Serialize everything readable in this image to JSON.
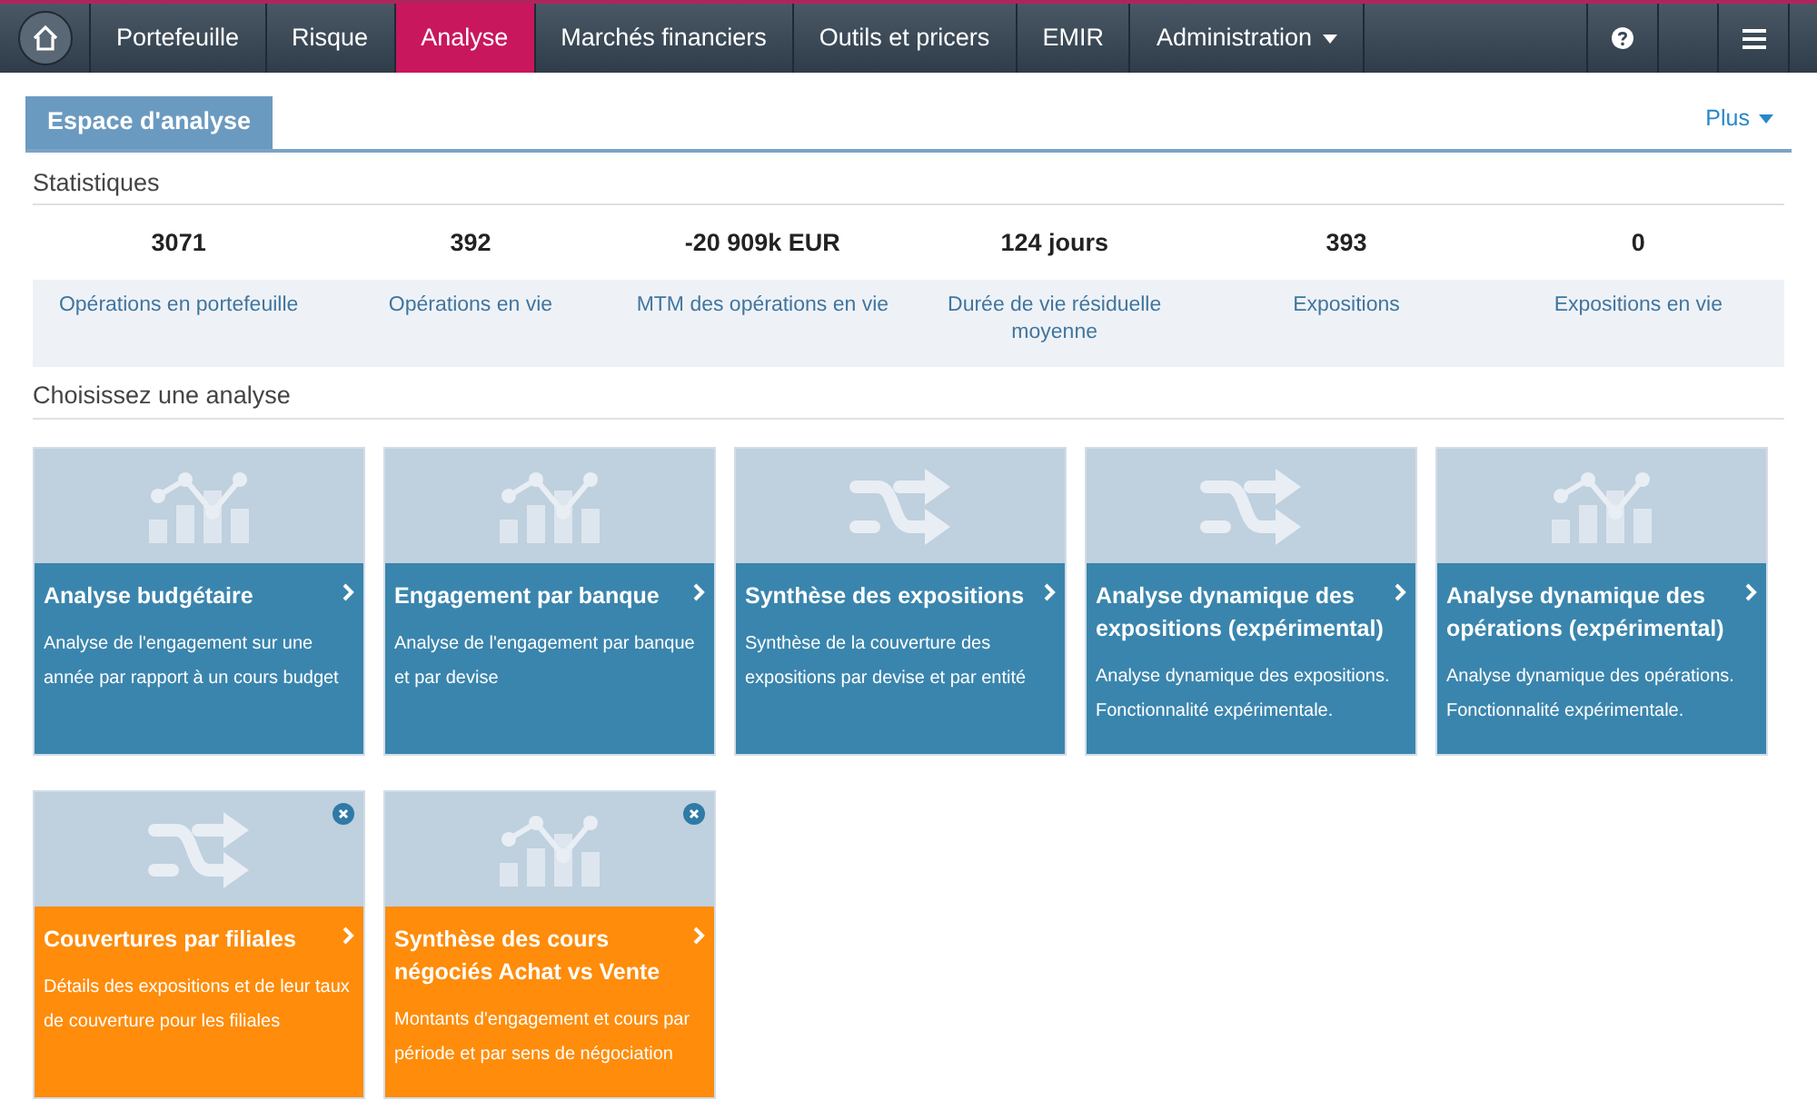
{
  "nav": {
    "items": [
      {
        "label": "Portefeuille",
        "selected": false,
        "dropdown": false
      },
      {
        "label": "Risque",
        "selected": false,
        "dropdown": false
      },
      {
        "label": "Analyse",
        "selected": true,
        "dropdown": false
      },
      {
        "label": "Marchés financiers",
        "selected": false,
        "dropdown": false
      },
      {
        "label": "Outils et pricers",
        "selected": false,
        "dropdown": false
      },
      {
        "label": "EMIR",
        "selected": false,
        "dropdown": false
      },
      {
        "label": "Administration",
        "selected": false,
        "dropdown": true
      }
    ]
  },
  "workspace_tabs": [
    {
      "label": "Espace d'analyse",
      "selected": true
    }
  ],
  "more_menu": "Plus",
  "statistics": {
    "title": "Statistiques",
    "items": [
      {
        "value": "3071",
        "label": "Opérations en portefeuille"
      },
      {
        "value": "392",
        "label": "Opérations en vie"
      },
      {
        "value": "-20 909k EUR",
        "label": "MTM des opérations en vie"
      },
      {
        "value": "124 jours",
        "label": "Durée de vie résiduelle moyenne"
      },
      {
        "value": "393",
        "label": "Expositions"
      },
      {
        "value": "0",
        "label": "Expositions en vie"
      }
    ]
  },
  "analyses": {
    "title": "Choisissez une analyse",
    "cards": [
      {
        "kind": "standard",
        "title": "Analyse budgétaire",
        "description": "Analyse de l'engagement sur une année par rapport à un cours budget"
      },
      {
        "kind": "standard",
        "title": "Engagement par banque",
        "description": "Analyse de l'engagement par banque et par devise"
      },
      {
        "kind": "standard",
        "title": "Synthèse des expositions",
        "description": "Synthèse de la couverture des expositions par devise et par entité"
      },
      {
        "kind": "standard",
        "title": "Analyse dynamique des expositions (expérimental)",
        "description": "Analyse dynamique des expositions. Fonctionnalité expérimentale."
      },
      {
        "kind": "standard",
        "title": "Analyse dynamique des opérations (expérimental)",
        "description": "Analyse dynamique des opérations. Fonctionnalité expérimentale."
      },
      {
        "kind": "custom",
        "title": "Couvertures par filiales",
        "description": "Détails des expositions et de leur taux de couverture pour les filiales"
      },
      {
        "kind": "custom",
        "title": "Synthèse des cours négociés Achat vs Vente",
        "description": "Montants d'engagement et cours par période et par sens de négociation"
      }
    ]
  }
}
